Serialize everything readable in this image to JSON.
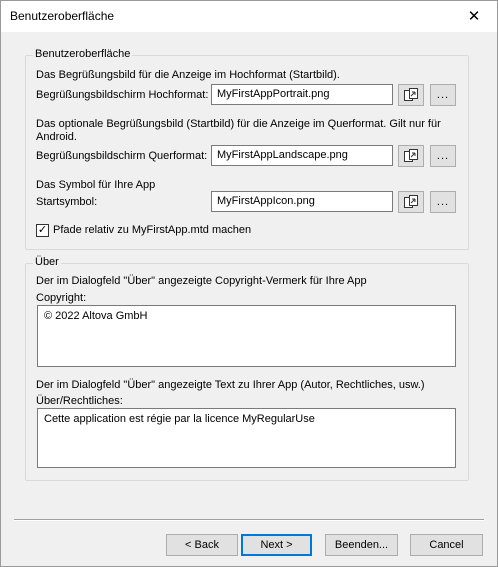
{
  "window": {
    "title": "Benutzeroberfläche",
    "close_glyph": "✕"
  },
  "ui_group": {
    "label": "Benutzeroberfläche",
    "portrait": {
      "description": "Das Begrüßungsbild für die Anzeige im Hochformat (Startbild).",
      "label": "Begrüßungsbildschirm Hochformat:",
      "value": "MyFirstAppPortrait.png"
    },
    "landscape": {
      "description": "Das optionale Begrüßungsbild (Startbild) für die Anzeige im Querformat. Gilt nur für Android.",
      "label": "Begrüßungsbildschirm Querformat:",
      "value": "MyFirstAppLandscape.png"
    },
    "icon": {
      "description": "Das Symbol für Ihre App",
      "label": "Startsymbol:",
      "value": "MyFirstAppIcon.png"
    },
    "browse_label": "...",
    "relative_paths": {
      "label": "Pfade relativ zu MyFirstApp.mtd machen",
      "checked": true
    }
  },
  "about_group": {
    "label": "Über",
    "copyright": {
      "description": "Der im Dialogfeld \"Über\" angezeigte Copyright-Vermerk für Ihre App",
      "label": "Copyright:",
      "value": "© 2022 Altova GmbH"
    },
    "legal": {
      "description": "Der im Dialogfeld \"Über\" angezeigte Text zu Ihrer App (Autor, Rechtliches, usw.)",
      "label": "Über/Rechtliches:",
      "value": "Cette application est régie par la licence MyRegularUse"
    }
  },
  "buttons": {
    "back": "< Back",
    "next": "Next >",
    "finish": "Beenden...",
    "cancel": "Cancel"
  }
}
